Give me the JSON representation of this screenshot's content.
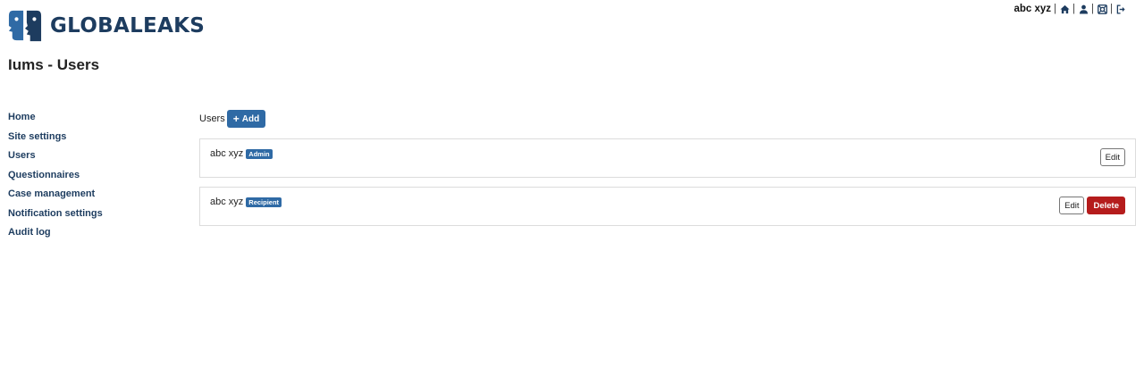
{
  "brand": {
    "name": "GLOBALEAKS",
    "color": "#1d3c5f"
  },
  "topbar": {
    "username": "abc xyz",
    "separator": "|",
    "icons": [
      "home-icon",
      "user-icon",
      "support-icon",
      "logout-icon"
    ]
  },
  "page": {
    "title": "Iums - Users"
  },
  "sidebar": {
    "items": [
      {
        "label": "Home"
      },
      {
        "label": "Site settings"
      },
      {
        "label": "Users"
      },
      {
        "label": "Questionnaires"
      },
      {
        "label": "Case management"
      },
      {
        "label": "Notification settings"
      },
      {
        "label": "Audit log"
      }
    ]
  },
  "users_section": {
    "label": "Users",
    "add_label": "Add",
    "add_icon": "+",
    "accent": "#2f6aa5"
  },
  "users": [
    {
      "name": "abc xyz",
      "role": "Admin",
      "edit_label": "Edit"
    },
    {
      "name": "abc xyz",
      "role": "Recipient",
      "edit_label": "Edit",
      "delete_label": "Delete",
      "delete_color": "#b51c1c"
    }
  ]
}
